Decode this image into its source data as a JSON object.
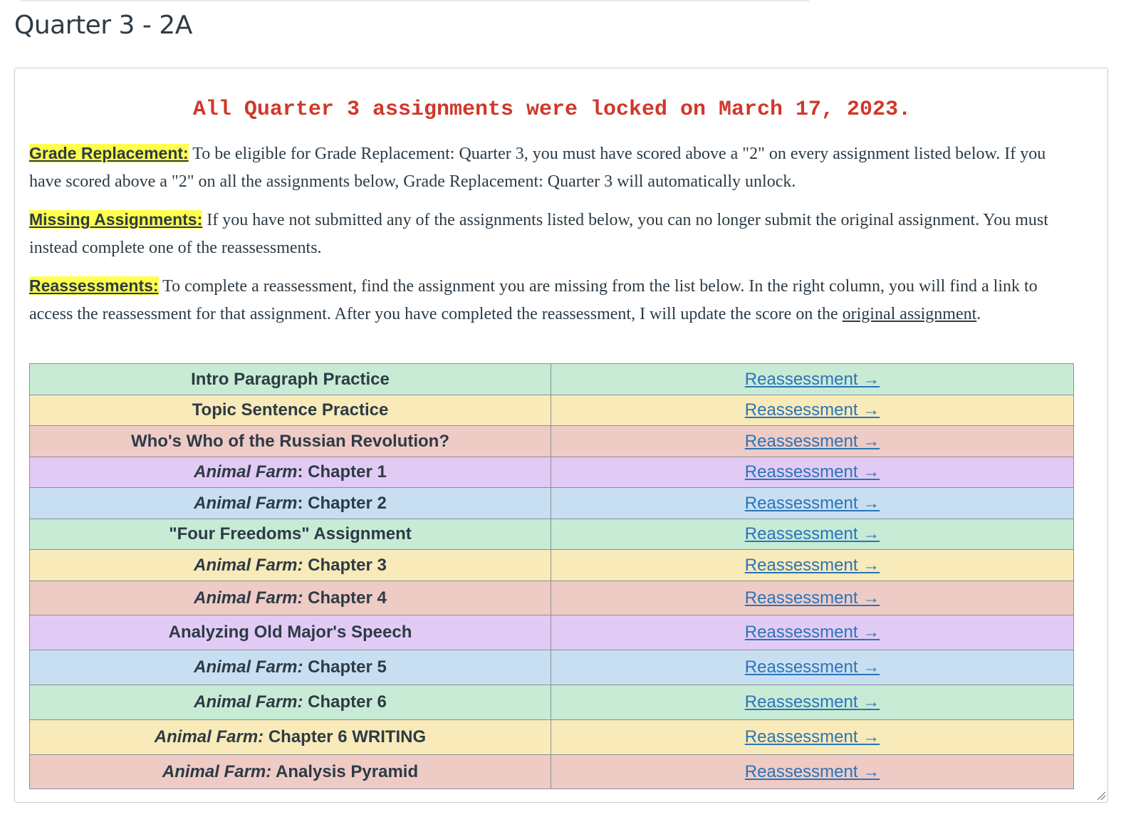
{
  "page": {
    "title": "Quarter 3 - 2A"
  },
  "notice": {
    "lock_text": "All Quarter 3 assignments were locked on March 17, 2023."
  },
  "sections": {
    "grade_replacement": {
      "label": "Grade Replacement:",
      "text": " To be eligible for Grade Replacement: Quarter 3, you must have scored above a \"2\" on every assignment listed below. If you have scored above a \"2\" on all the assignments below, Grade Replacement: Quarter 3 will automatically unlock."
    },
    "missing_assignments": {
      "label": "Missing Assignments:",
      "text": " If you have not submitted any of the assignments listed below, you can no longer submit the original assignment. You must instead complete one of the reassessments."
    },
    "reassessments": {
      "label": "Reassessments:",
      "text": " To complete a reassessment, find the assignment you are missing from the list below. In the right column, you will find a link to access the reassessment for that assignment. After you have completed the reassessment, I will update the score on the ",
      "link_text": "original assignment",
      "suffix": "."
    }
  },
  "colors": {
    "green": "#c8ebd6",
    "yellow": "#f8eab9",
    "red": "#efcbc6",
    "purple": "#e1cbf5",
    "blue": "#c8dff2",
    "lock_red": "#d0382a",
    "highlight": "#ffff4d",
    "link_blue": "#2b74b8"
  },
  "table": {
    "rows": [
      {
        "italic": "",
        "title": "Intro Paragraph Practice",
        "link": "Reassessment →",
        "color": "green",
        "height": 44
      },
      {
        "italic": "",
        "title": "Topic Sentence Practice",
        "link": "Reassessment →",
        "color": "yellow",
        "height": 43
      },
      {
        "italic": "",
        "title": "Who's Who of the Russian Revolution?",
        "link": "Reassessment →",
        "color": "red",
        "height": 44
      },
      {
        "italic": "Animal Farm",
        "title": ": Chapter 1",
        "link": "Reassessment →",
        "color": "purple",
        "height": 43
      },
      {
        "italic": "Animal Farm",
        "title": ": Chapter 2",
        "link": "Reassessment →",
        "color": "blue",
        "height": 44
      },
      {
        "italic": "",
        "title": "\"Four Freedoms\" Assignment",
        "link": "Reassessment →",
        "color": "green",
        "height": 43
      },
      {
        "italic": "Animal Farm:",
        "title": " Chapter 3",
        "link": "Reassessment →",
        "color": "yellow",
        "height": 44
      },
      {
        "italic": "Animal Farm:",
        "title": " Chapter 4",
        "link": "Reassessment →",
        "color": "red",
        "height": 48
      },
      {
        "italic": "",
        "title": "Analyzing Old Major's Speech",
        "link": "Reassessment →",
        "color": "purple",
        "height": 49
      },
      {
        "italic": "Animal Farm:",
        "title": " Chapter 5",
        "link": "Reassessment →",
        "color": "blue",
        "height": 49
      },
      {
        "italic": "Animal Farm:",
        "title": " Chapter 6",
        "link": "Reassessment →",
        "color": "green",
        "height": 49
      },
      {
        "italic": "Animal Farm:",
        "title": " Chapter 6 WRITING",
        "link": "Reassessment →",
        "color": "yellow",
        "height": 49
      },
      {
        "italic": "Animal Farm:",
        "title": " Analysis Pyramid",
        "link": "Reassessment →",
        "color": "red",
        "height": 48
      }
    ]
  }
}
